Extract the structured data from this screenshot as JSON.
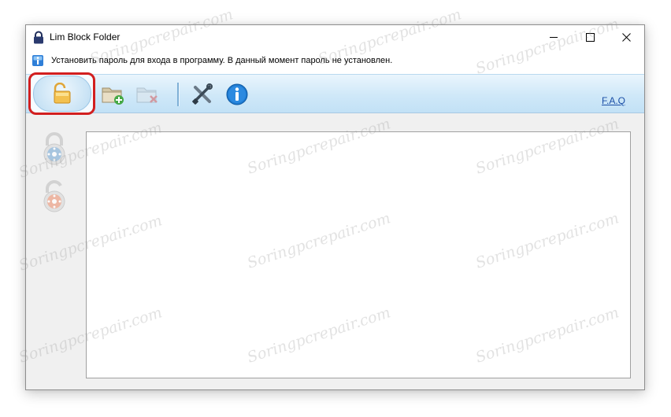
{
  "window": {
    "title": "Lim Block Folder",
    "title_icon": "padlock-icon",
    "controls": [
      "minimize-icon",
      "maximize-icon",
      "close-icon"
    ]
  },
  "info_bar": {
    "icon": "info-small-icon",
    "text": "Установить пароль для входа в программу. В данный момент пароль не установлен."
  },
  "toolbar": {
    "items": [
      "set-password-button",
      "add-folder-button",
      "remove-folder-button",
      "settings-button",
      "about-button"
    ],
    "faq_label": "F.A.Q"
  },
  "sidebar": {
    "items": [
      "lock-folder-button",
      "unlock-folder-button"
    ]
  },
  "watermark": "Soringpcrepair.com",
  "colors": {
    "highlight": "#d21f1f",
    "toolbar_top": "#eaf5fd",
    "toolbar_bottom": "#c2e1f6",
    "link": "#1a4ea6"
  }
}
